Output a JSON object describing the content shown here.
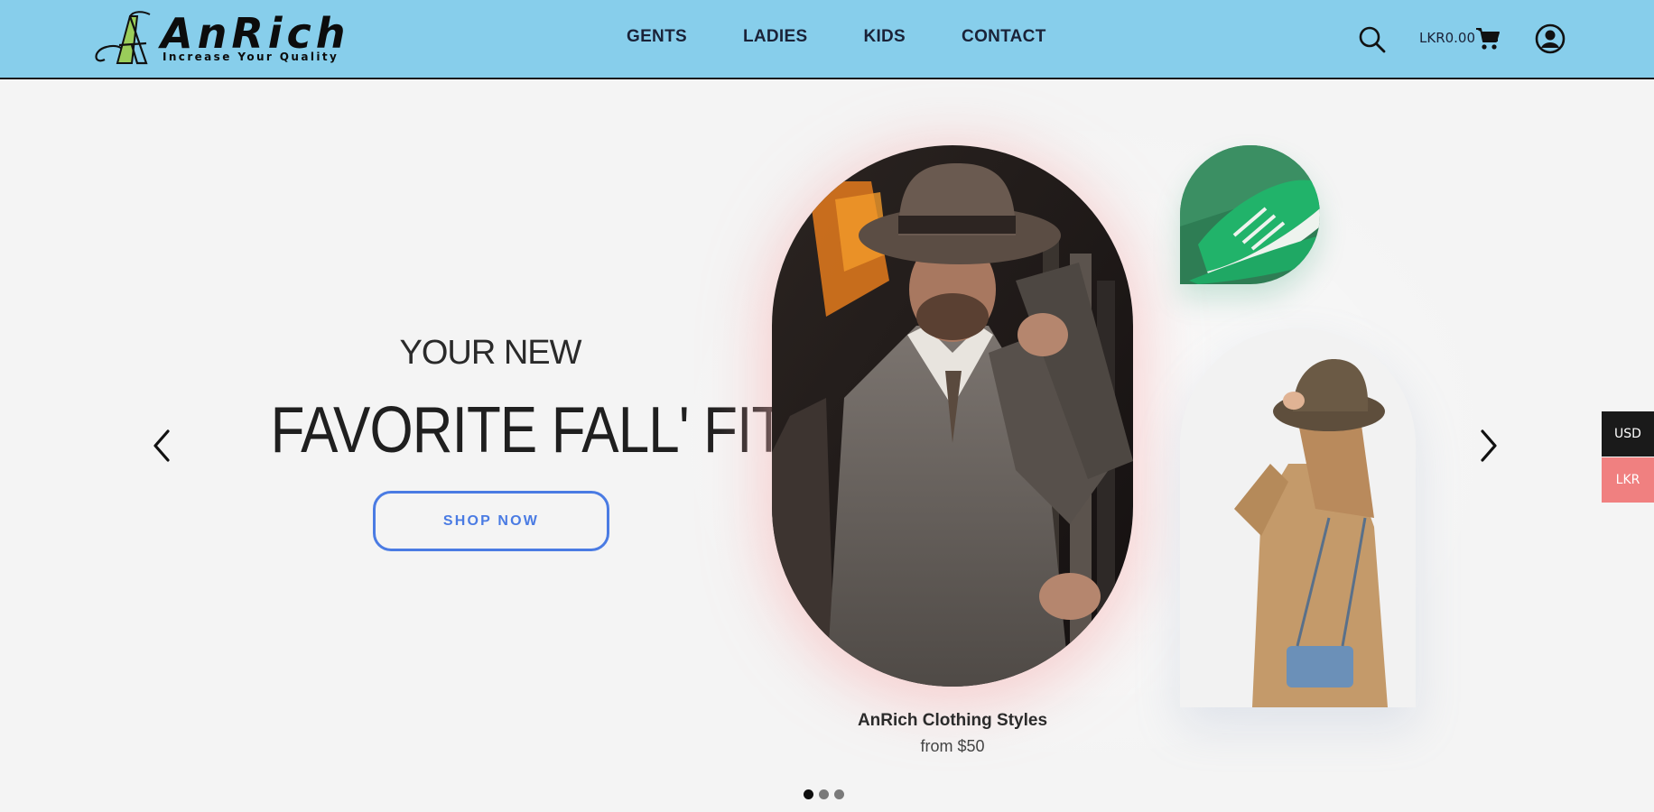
{
  "brand": {
    "name": "AnRich",
    "tagline": "Increase Your Quality",
    "logo_accent": "#9acd5a"
  },
  "header": {
    "background": "#87ceeb",
    "nav": [
      {
        "label": "GENTS"
      },
      {
        "label": "LADIES"
      },
      {
        "label": "KIDS"
      },
      {
        "label": "CONTACT"
      }
    ],
    "search_icon": "search-icon",
    "cart": {
      "total": "LKR0.00",
      "icon": "cart-icon"
    },
    "account_icon": "user-circle-icon"
  },
  "hero": {
    "eyebrow": "YOUR NEW",
    "headline": "FAVORITE FALL' FITS",
    "cta_label": "SHOP NOW",
    "cta_color": "#4a7be3",
    "prev_icon": "chevron-left-icon",
    "next_icon": "chevron-right-icon",
    "featured": {
      "title": "AnRich Clothing Styles",
      "price": "from $50"
    },
    "slides": {
      "count": 3,
      "active_index": 0
    }
  },
  "currency": {
    "options": [
      {
        "label": "USD",
        "color": "#1a1a1a"
      },
      {
        "label": "LKR",
        "color": "#f08080"
      }
    ]
  }
}
